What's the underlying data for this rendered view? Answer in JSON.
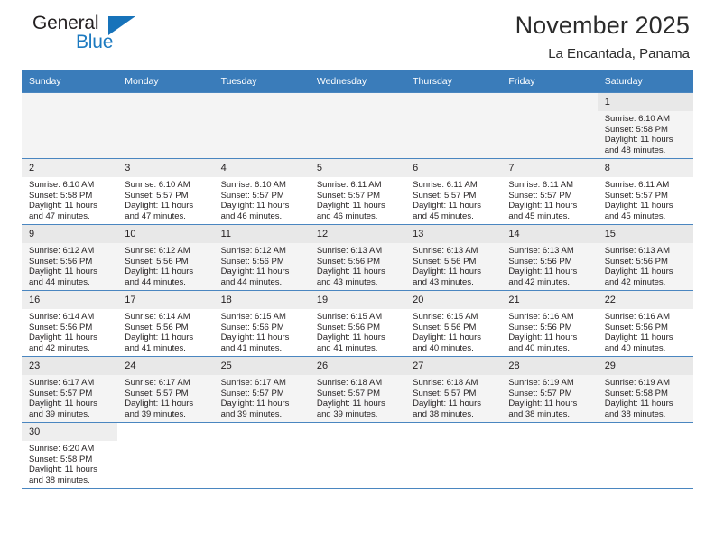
{
  "brand": {
    "line1": "General",
    "line2": "Blue",
    "flag_icon": "blue-triangle-flag-icon",
    "color_dark": "#231f20",
    "color_blue": "#1c7ac0"
  },
  "header": {
    "title": "November 2025",
    "subtitle": "La Encantada, Panama"
  },
  "theme": {
    "header_bg": "#3a7cba",
    "header_text": "#ffffff",
    "grid_line": "#4a86c0",
    "row_shade": "#f4f4f4",
    "daynum_bg": "#eeeeee"
  },
  "calendar": {
    "weekday_headers": [
      "Sunday",
      "Monday",
      "Tuesday",
      "Wednesday",
      "Thursday",
      "Friday",
      "Saturday"
    ],
    "labels": {
      "sunrise": "Sunrise:",
      "sunset": "Sunset:",
      "daylight": "Daylight:"
    },
    "weeks": [
      [
        {
          "day": "",
          "sunrise": "",
          "sunset": "",
          "daylight1": "",
          "daylight2": ""
        },
        {
          "day": "",
          "sunrise": "",
          "sunset": "",
          "daylight1": "",
          "daylight2": ""
        },
        {
          "day": "",
          "sunrise": "",
          "sunset": "",
          "daylight1": "",
          "daylight2": ""
        },
        {
          "day": "",
          "sunrise": "",
          "sunset": "",
          "daylight1": "",
          "daylight2": ""
        },
        {
          "day": "",
          "sunrise": "",
          "sunset": "",
          "daylight1": "",
          "daylight2": ""
        },
        {
          "day": "",
          "sunrise": "",
          "sunset": "",
          "daylight1": "",
          "daylight2": ""
        },
        {
          "day": "1",
          "sunrise": "Sunrise: 6:10 AM",
          "sunset": "Sunset: 5:58 PM",
          "daylight1": "Daylight: 11 hours",
          "daylight2": "and 48 minutes."
        }
      ],
      [
        {
          "day": "2",
          "sunrise": "Sunrise: 6:10 AM",
          "sunset": "Sunset: 5:58 PM",
          "daylight1": "Daylight: 11 hours",
          "daylight2": "and 47 minutes."
        },
        {
          "day": "3",
          "sunrise": "Sunrise: 6:10 AM",
          "sunset": "Sunset: 5:57 PM",
          "daylight1": "Daylight: 11 hours",
          "daylight2": "and 47 minutes."
        },
        {
          "day": "4",
          "sunrise": "Sunrise: 6:10 AM",
          "sunset": "Sunset: 5:57 PM",
          "daylight1": "Daylight: 11 hours",
          "daylight2": "and 46 minutes."
        },
        {
          "day": "5",
          "sunrise": "Sunrise: 6:11 AM",
          "sunset": "Sunset: 5:57 PM",
          "daylight1": "Daylight: 11 hours",
          "daylight2": "and 46 minutes."
        },
        {
          "day": "6",
          "sunrise": "Sunrise: 6:11 AM",
          "sunset": "Sunset: 5:57 PM",
          "daylight1": "Daylight: 11 hours",
          "daylight2": "and 45 minutes."
        },
        {
          "day": "7",
          "sunrise": "Sunrise: 6:11 AM",
          "sunset": "Sunset: 5:57 PM",
          "daylight1": "Daylight: 11 hours",
          "daylight2": "and 45 minutes."
        },
        {
          "day": "8",
          "sunrise": "Sunrise: 6:11 AM",
          "sunset": "Sunset: 5:57 PM",
          "daylight1": "Daylight: 11 hours",
          "daylight2": "and 45 minutes."
        }
      ],
      [
        {
          "day": "9",
          "sunrise": "Sunrise: 6:12 AM",
          "sunset": "Sunset: 5:56 PM",
          "daylight1": "Daylight: 11 hours",
          "daylight2": "and 44 minutes."
        },
        {
          "day": "10",
          "sunrise": "Sunrise: 6:12 AM",
          "sunset": "Sunset: 5:56 PM",
          "daylight1": "Daylight: 11 hours",
          "daylight2": "and 44 minutes."
        },
        {
          "day": "11",
          "sunrise": "Sunrise: 6:12 AM",
          "sunset": "Sunset: 5:56 PM",
          "daylight1": "Daylight: 11 hours",
          "daylight2": "and 44 minutes."
        },
        {
          "day": "12",
          "sunrise": "Sunrise: 6:13 AM",
          "sunset": "Sunset: 5:56 PM",
          "daylight1": "Daylight: 11 hours",
          "daylight2": "and 43 minutes."
        },
        {
          "day": "13",
          "sunrise": "Sunrise: 6:13 AM",
          "sunset": "Sunset: 5:56 PM",
          "daylight1": "Daylight: 11 hours",
          "daylight2": "and 43 minutes."
        },
        {
          "day": "14",
          "sunrise": "Sunrise: 6:13 AM",
          "sunset": "Sunset: 5:56 PM",
          "daylight1": "Daylight: 11 hours",
          "daylight2": "and 42 minutes."
        },
        {
          "day": "15",
          "sunrise": "Sunrise: 6:13 AM",
          "sunset": "Sunset: 5:56 PM",
          "daylight1": "Daylight: 11 hours",
          "daylight2": "and 42 minutes."
        }
      ],
      [
        {
          "day": "16",
          "sunrise": "Sunrise: 6:14 AM",
          "sunset": "Sunset: 5:56 PM",
          "daylight1": "Daylight: 11 hours",
          "daylight2": "and 42 minutes."
        },
        {
          "day": "17",
          "sunrise": "Sunrise: 6:14 AM",
          "sunset": "Sunset: 5:56 PM",
          "daylight1": "Daylight: 11 hours",
          "daylight2": "and 41 minutes."
        },
        {
          "day": "18",
          "sunrise": "Sunrise: 6:15 AM",
          "sunset": "Sunset: 5:56 PM",
          "daylight1": "Daylight: 11 hours",
          "daylight2": "and 41 minutes."
        },
        {
          "day": "19",
          "sunrise": "Sunrise: 6:15 AM",
          "sunset": "Sunset: 5:56 PM",
          "daylight1": "Daylight: 11 hours",
          "daylight2": "and 41 minutes."
        },
        {
          "day": "20",
          "sunrise": "Sunrise: 6:15 AM",
          "sunset": "Sunset: 5:56 PM",
          "daylight1": "Daylight: 11 hours",
          "daylight2": "and 40 minutes."
        },
        {
          "day": "21",
          "sunrise": "Sunrise: 6:16 AM",
          "sunset": "Sunset: 5:56 PM",
          "daylight1": "Daylight: 11 hours",
          "daylight2": "and 40 minutes."
        },
        {
          "day": "22",
          "sunrise": "Sunrise: 6:16 AM",
          "sunset": "Sunset: 5:56 PM",
          "daylight1": "Daylight: 11 hours",
          "daylight2": "and 40 minutes."
        }
      ],
      [
        {
          "day": "23",
          "sunrise": "Sunrise: 6:17 AM",
          "sunset": "Sunset: 5:57 PM",
          "daylight1": "Daylight: 11 hours",
          "daylight2": "and 39 minutes."
        },
        {
          "day": "24",
          "sunrise": "Sunrise: 6:17 AM",
          "sunset": "Sunset: 5:57 PM",
          "daylight1": "Daylight: 11 hours",
          "daylight2": "and 39 minutes."
        },
        {
          "day": "25",
          "sunrise": "Sunrise: 6:17 AM",
          "sunset": "Sunset: 5:57 PM",
          "daylight1": "Daylight: 11 hours",
          "daylight2": "and 39 minutes."
        },
        {
          "day": "26",
          "sunrise": "Sunrise: 6:18 AM",
          "sunset": "Sunset: 5:57 PM",
          "daylight1": "Daylight: 11 hours",
          "daylight2": "and 39 minutes."
        },
        {
          "day": "27",
          "sunrise": "Sunrise: 6:18 AM",
          "sunset": "Sunset: 5:57 PM",
          "daylight1": "Daylight: 11 hours",
          "daylight2": "and 38 minutes."
        },
        {
          "day": "28",
          "sunrise": "Sunrise: 6:19 AM",
          "sunset": "Sunset: 5:57 PM",
          "daylight1": "Daylight: 11 hours",
          "daylight2": "and 38 minutes."
        },
        {
          "day": "29",
          "sunrise": "Sunrise: 6:19 AM",
          "sunset": "Sunset: 5:58 PM",
          "daylight1": "Daylight: 11 hours",
          "daylight2": "and 38 minutes."
        }
      ],
      [
        {
          "day": "30",
          "sunrise": "Sunrise: 6:20 AM",
          "sunset": "Sunset: 5:58 PM",
          "daylight1": "Daylight: 11 hours",
          "daylight2": "and 38 minutes."
        },
        {
          "day": "",
          "sunrise": "",
          "sunset": "",
          "daylight1": "",
          "daylight2": ""
        },
        {
          "day": "",
          "sunrise": "",
          "sunset": "",
          "daylight1": "",
          "daylight2": ""
        },
        {
          "day": "",
          "sunrise": "",
          "sunset": "",
          "daylight1": "",
          "daylight2": ""
        },
        {
          "day": "",
          "sunrise": "",
          "sunset": "",
          "daylight1": "",
          "daylight2": ""
        },
        {
          "day": "",
          "sunrise": "",
          "sunset": "",
          "daylight1": "",
          "daylight2": ""
        },
        {
          "day": "",
          "sunrise": "",
          "sunset": "",
          "daylight1": "",
          "daylight2": ""
        }
      ]
    ]
  }
}
